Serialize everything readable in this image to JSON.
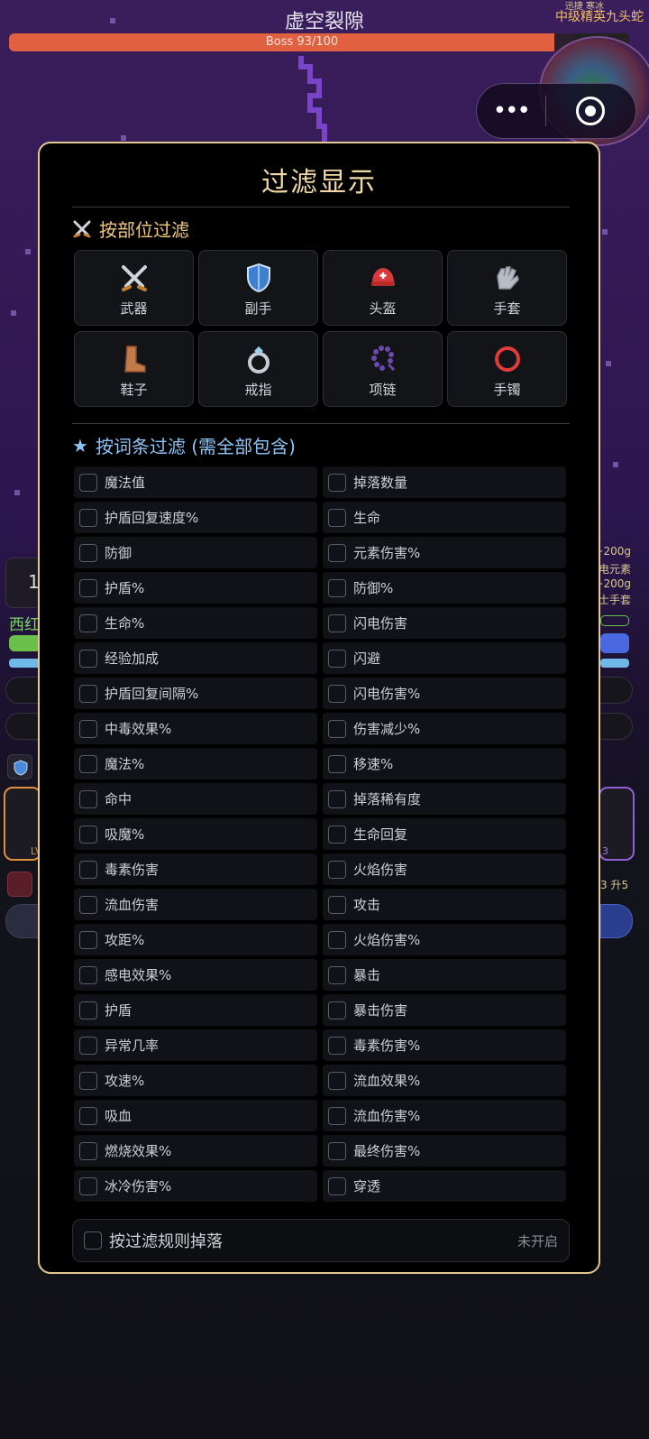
{
  "game": {
    "title": "虚空裂隙",
    "boss_bar_text": "Boss 93/100",
    "boss_progress": 0.93,
    "boss_name": "中级精英九头蛇",
    "boss_tag": "迅捷 寒冰"
  },
  "background": {
    "left_level": "1",
    "left_name": "西红",
    "right_line1": "+200g",
    "right_line2": "电元素",
    "right_line3": "+200g",
    "right_line4": "士手套",
    "left_card_label": "LV",
    "right_card_label": "3",
    "right_upgrade": "3 升5"
  },
  "modal": {
    "title": "过滤显示",
    "slot_section_title": "按部位过滤",
    "slots": [
      {
        "label": "武器",
        "icon": "crossed-swords-icon"
      },
      {
        "label": "副手",
        "icon": "shield-icon"
      },
      {
        "label": "头盔",
        "icon": "helmet-icon"
      },
      {
        "label": "手套",
        "icon": "gloves-icon"
      },
      {
        "label": "鞋子",
        "icon": "boot-icon"
      },
      {
        "label": "戒指",
        "icon": "ring-icon"
      },
      {
        "label": "项链",
        "icon": "necklace-icon"
      },
      {
        "label": "手镯",
        "icon": "bracelet-icon"
      }
    ],
    "attr_section_title": "按词条过滤 (需全部包含)",
    "attributes": [
      "魔法值",
      "掉落数量",
      "护盾回复速度%",
      "生命",
      "防御",
      "元素伤害%",
      "护盾%",
      "防御%",
      "生命%",
      "闪电伤害",
      "经验加成",
      "闪避",
      "护盾回复间隔%",
      "闪电伤害%",
      "中毒效果%",
      "伤害减少%",
      "魔法%",
      "移速%",
      "命中",
      "掉落稀有度",
      "吸魔%",
      "生命回复",
      "毒素伤害",
      "火焰伤害",
      "流血伤害",
      "攻击",
      "攻距%",
      "火焰伤害%",
      "感电效果%",
      "暴击",
      "护盾",
      "暴击伤害",
      "异常几率",
      "毒素伤害%",
      "攻速%",
      "流血效果%",
      "吸血",
      "流血伤害%",
      "燃烧效果%",
      "最终伤害%",
      "冰冷伤害%",
      "穿透"
    ],
    "footer_label": "按过滤规则掉落",
    "footer_status": "未开启"
  },
  "colors": {
    "accent_gold": "#e5c890",
    "section_blue": "#8fc4f4",
    "boss_bar": "#e06040"
  }
}
